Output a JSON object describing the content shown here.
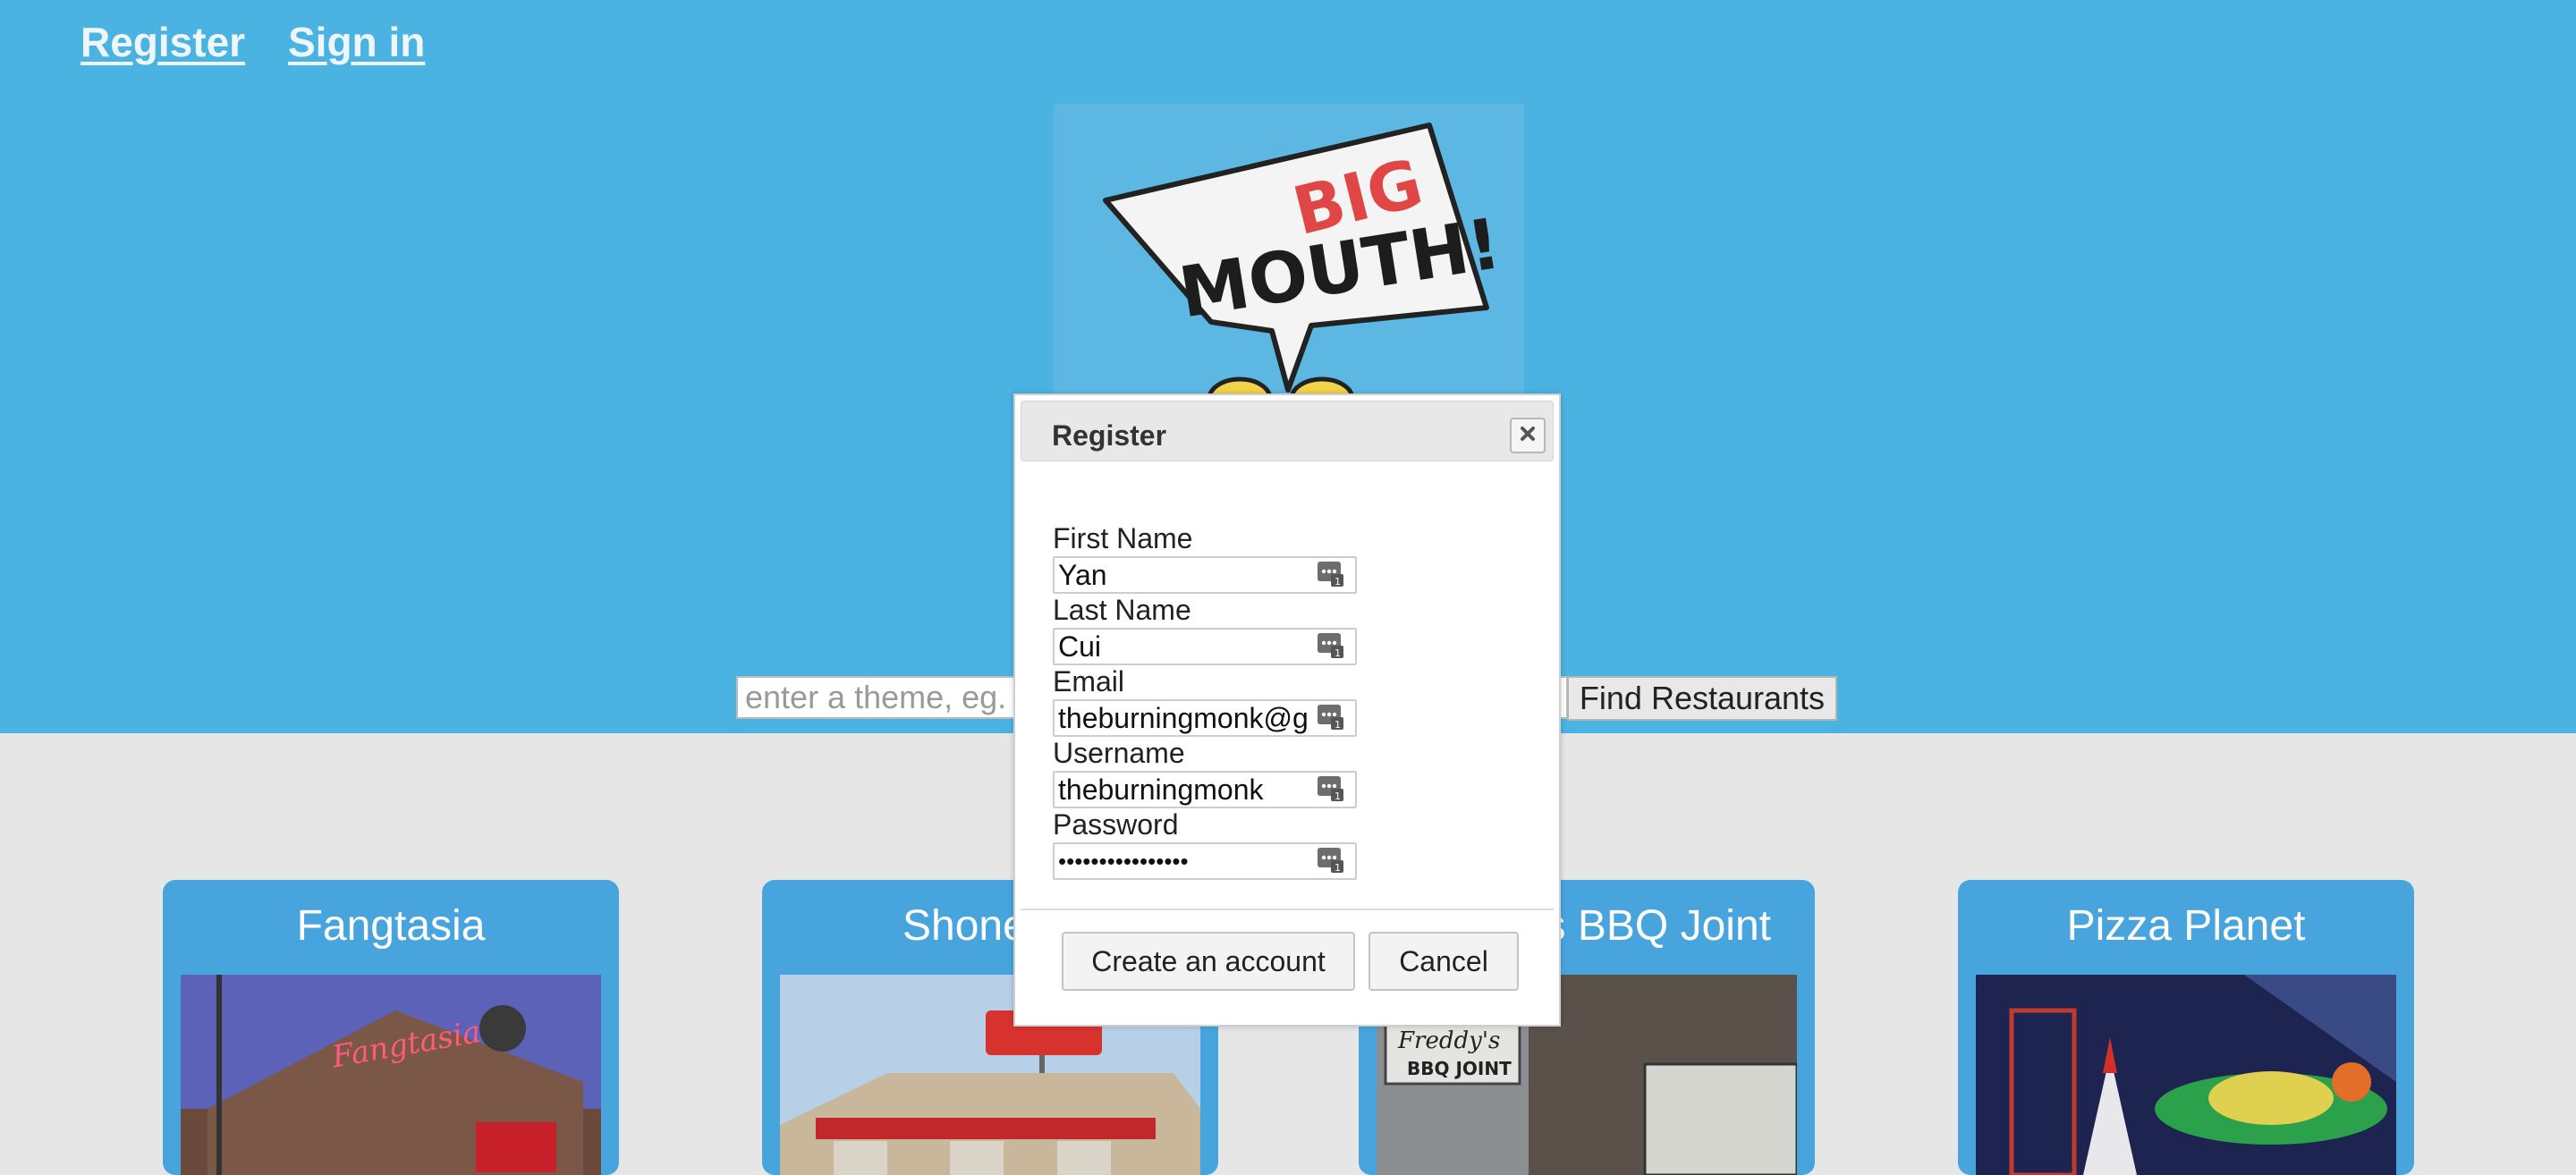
{
  "nav": {
    "register_label": "Register",
    "signin_label": "Sign in"
  },
  "logo": {
    "text_big": "BIG",
    "text_mouth": "MOUTH!"
  },
  "search": {
    "placeholder": "enter a theme, eg. rock",
    "button_label": "Find Restaurants"
  },
  "restaurants": [
    {
      "name": "Fangtasia"
    },
    {
      "name": "Shoney's"
    },
    {
      "name": "Freddy's BBQ Joint"
    },
    {
      "name": "Pizza Planet"
    }
  ],
  "modal": {
    "title": "Register",
    "fields": [
      {
        "label": "First Name",
        "value": "Yan"
      },
      {
        "label": "Last Name",
        "value": "Cui"
      },
      {
        "label": "Email",
        "value": "theburningmonk@gmail.com"
      },
      {
        "label": "Username",
        "value": "theburningmonk"
      },
      {
        "label": "Password",
        "value": "••••••••••••••••"
      }
    ],
    "create_label": "Create an account",
    "cancel_label": "Cancel"
  },
  "colors": {
    "top_band": "#4ab3e2",
    "bottom_band": "#e6e6e6",
    "card": "#47a4dd",
    "logo_red": "#e04646"
  }
}
